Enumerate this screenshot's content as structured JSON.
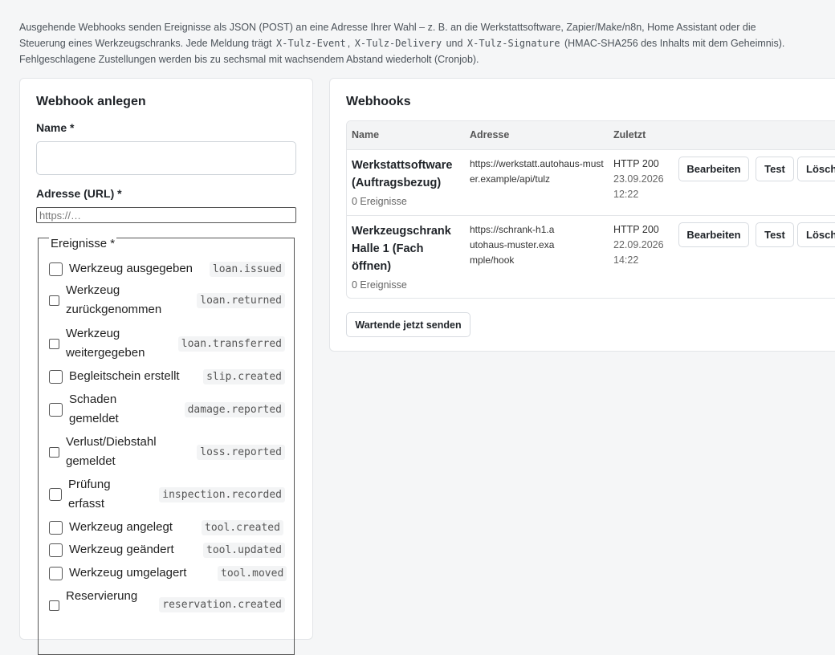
{
  "intro": {
    "line1": "Ausgehende Webhooks senden Ereignisse als JSON (POST) an eine Adresse Ihrer Wahl – z. B. an die Werkstattsoftware, Zapier/Make/n8n, Home Assistant oder die",
    "line2_pre": "Steuerung eines Werkzeugschranks. Jede Meldung trägt",
    "header_event": "X-Tulz-Event",
    "sep1": ",",
    "header_delivery": "X-Tulz-Delivery",
    "sep2": "und",
    "header_signature": "X-Tulz-Signature",
    "line2_post": "(HMAC-SHA256 des Inhalts mit dem Geheimnis).",
    "line3": "Fehlgeschlagene Zustellungen werden bis zu sechsmal mit wachsendem Abstand wiederholt (Cronjob)."
  },
  "form": {
    "title": "Webhook anlegen",
    "name_label": "Name *",
    "name_value": "",
    "url_label": "Adresse (URL) *",
    "url_placeholder": "https://…",
    "events_legend": "Ereignisse *",
    "events": [
      {
        "label": "Werkzeug ausgegeben",
        "code": "loan.issued",
        "checked": false
      },
      {
        "label": "Werkzeug zurückgenommen",
        "code": "loan.returned",
        "checked": false
      },
      {
        "label": "Werkzeug weitergegeben",
        "code": "loan.transferred",
        "checked": false
      },
      {
        "label": "Begleitschein erstellt",
        "code": "slip.created",
        "checked": false
      },
      {
        "label": "Schaden gemeldet",
        "code": "damage.reported",
        "checked": false
      },
      {
        "label": "Verlust/Diebstahl gemeldet",
        "code": "loss.reported",
        "checked": false
      },
      {
        "label": "Prüfung erfasst",
        "code": "inspection.recorded",
        "checked": false
      },
      {
        "label": "Werkzeug angelegt",
        "code": "tool.created",
        "checked": false
      },
      {
        "label": "Werkzeug geändert",
        "code": "tool.updated",
        "checked": false
      },
      {
        "label": "Werkzeug umgelagert",
        "code": "tool.moved",
        "checked": false
      },
      {
        "label": "Reservierung",
        "code": "reservation.created",
        "checked": false
      }
    ]
  },
  "list": {
    "title": "Webhooks",
    "columns": [
      "Name",
      "Adresse",
      "Zuletzt"
    ],
    "rows": [
      {
        "name": "Werkstattsoftware (Auftragsbezug)",
        "events": "0 Ereignisse",
        "url": "https://werkstatt.autohaus-muster.example/api/tulz",
        "status": "HTTP 200",
        "date": "23.09.2026",
        "time": "12:22"
      },
      {
        "name": "Werkzeugschrank Halle 1 (Fach öffnen)",
        "events": "0 Ereignisse",
        "url": "https://schrank-h1.autohaus-muster.example/hook",
        "status": "HTTP 200",
        "date": "22.09.2026",
        "time": "14:22"
      }
    ],
    "btn_edit": "Bearbeiten",
    "btn_test": "Test",
    "btn_delete": "Lösch",
    "btn_send_pending": "Wartende jetzt senden"
  }
}
